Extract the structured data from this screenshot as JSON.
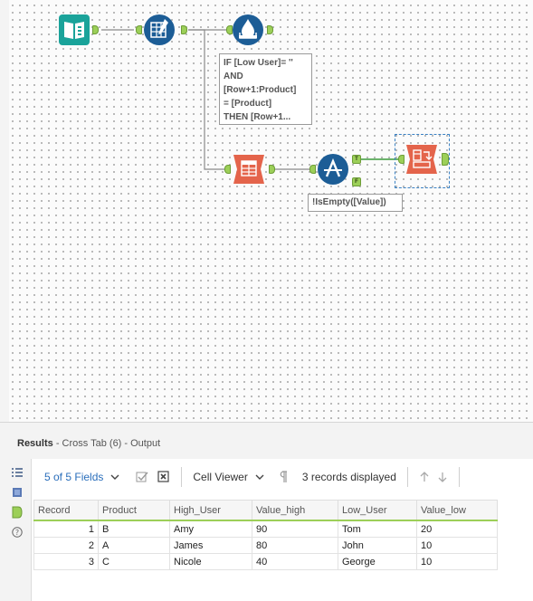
{
  "workflow": {
    "annotation_formula": "IF [Low User]= ''\nAND\n[Row+1:Product]\n= [Product]\nTHEN [Row+1...",
    "annotation_filter": "!IsEmpty([Value])",
    "true_anchor": "T",
    "false_anchor": "F",
    "colors": {
      "input_tool": "#1aa39a",
      "prep_tool": "#1c5d96",
      "transform_tool": "#e4644b",
      "anchor": "#9ccf58"
    }
  },
  "results": {
    "title": "Results",
    "subtitle": "- Cross Tab (6) - Output",
    "toolbar": {
      "fields": "5 of 5 Fields",
      "cell_viewer": "Cell Viewer",
      "records": "3 records displayed"
    },
    "table": {
      "headers": [
        "Record",
        "Product",
        "High_User",
        "Value_high",
        "Low_User",
        "Value_low"
      ],
      "rows": [
        [
          "1",
          "B",
          "Amy",
          "90",
          "Tom",
          "20"
        ],
        [
          "2",
          "A",
          "James",
          "80",
          "John",
          "10"
        ],
        [
          "3",
          "C",
          "Nicole",
          "40",
          "George",
          "10"
        ]
      ]
    }
  }
}
